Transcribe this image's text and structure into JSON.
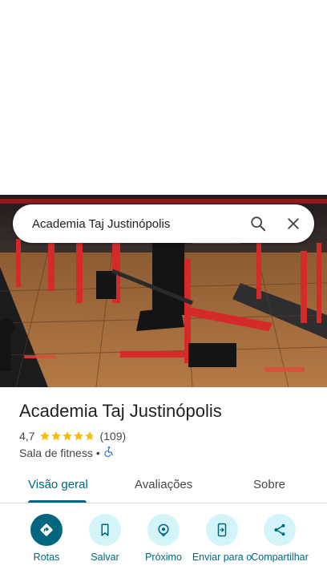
{
  "search": {
    "query": "Academia Taj Justinópolis"
  },
  "place": {
    "name": "Academia Taj Justinópolis",
    "rating": "4,7",
    "rating_value": 4.7,
    "review_count": "(109)",
    "category": "Sala de fitness",
    "separator": "•"
  },
  "tabs": [
    {
      "label": "Visão geral",
      "active": true
    },
    {
      "label": "Avaliações",
      "active": false
    },
    {
      "label": "Sobre",
      "active": false
    }
  ],
  "actions": [
    {
      "label": "Rotas",
      "icon": "directions-icon"
    },
    {
      "label": "Salvar",
      "icon": "bookmark-icon"
    },
    {
      "label": "Próximo",
      "icon": "nearby-icon"
    },
    {
      "label": "Enviar para o",
      "icon": "send-to-phone-icon"
    },
    {
      "label": "Compartilhar",
      "icon": "share-icon"
    }
  ],
  "colors": {
    "accent": "#00677f",
    "accent_light": "#d3f4f9",
    "star": "#fbbc04",
    "accessibility": "#1a73e8"
  }
}
